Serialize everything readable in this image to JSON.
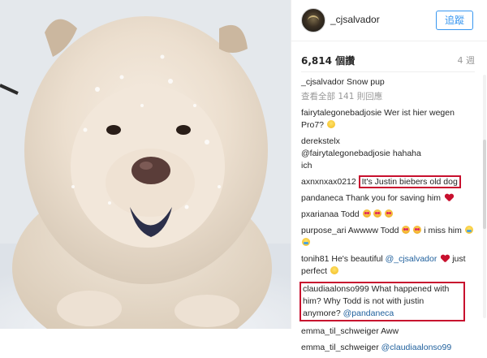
{
  "header": {
    "username": "_cjsalvador",
    "follow_label": "追蹤"
  },
  "post": {
    "views": "6,814 個讚",
    "age": "4 週",
    "load_more": "查看全部 141 則回應"
  },
  "comments": [
    {
      "user": "_cjsalvador",
      "text": "Snow pup"
    },
    {
      "user": "fairytalegonebadjosie",
      "text": "Wer ist hier wegen Pro7?"
    },
    {
      "user": "derekstelx",
      "text": "@fairytalegonebadjosie hahaha ich"
    },
    {
      "user": "axnxnxax0212",
      "text": "It's Justin biebers old dog"
    },
    {
      "user": "pandaneca",
      "text": "Thank you for saving him"
    },
    {
      "user": "pxarianaa",
      "text": "Todd"
    },
    {
      "user": "purpose_ari",
      "text": "Awwww Todd",
      "text2": "i miss him"
    },
    {
      "user": "tonih81",
      "text": "He's beautiful",
      "mention": "@_cjsalvador",
      "text2": "just perfect"
    },
    {
      "user": "claudiaalonso999",
      "text": "What happened with",
      "text2": "him? Why Todd is not with justin",
      "text3": "anymore?",
      "mention": "@pandaneca"
    },
    {
      "user": "emma_til_schweiger",
      "text": "Aww"
    },
    {
      "user": "emma_til_schweiger",
      "mention": "@claudiaalonso99"
    }
  ],
  "colors": {
    "accent": "#3897f0",
    "highlight_box": "#c8102e",
    "mention": "#1e5f9c"
  }
}
